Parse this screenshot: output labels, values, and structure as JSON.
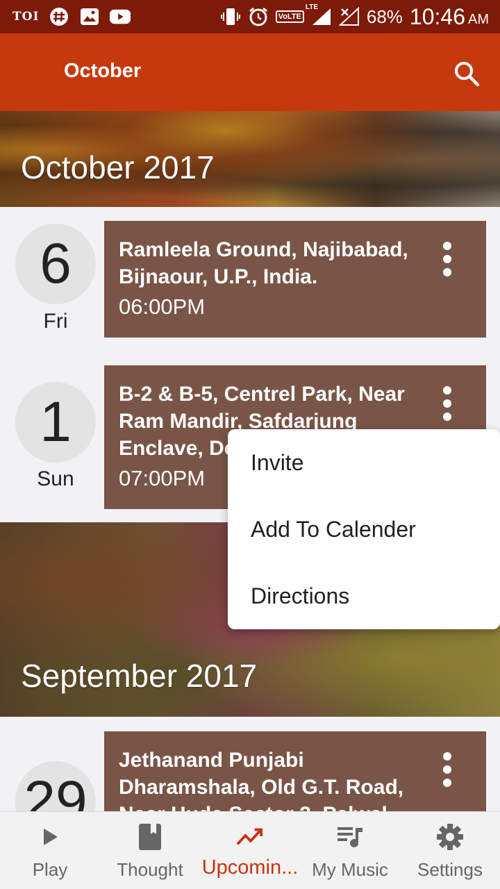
{
  "status_bar": {
    "carrier_label": "TOI",
    "volte_label": "VoLTE",
    "lte_label": "LTE",
    "battery": "68%",
    "time": "10:46",
    "ampm": "AM"
  },
  "app_bar": {
    "title": "October",
    "search_icon": "search-icon"
  },
  "sections": [
    {
      "month": "October 2017",
      "events": [
        {
          "day": "6",
          "weekday": "Fri",
          "location": "Ramleela Ground, Najibabad, Bijnaour, U.P., India.",
          "time": "06:00PM"
        },
        {
          "day": "1",
          "weekday": "Sun",
          "location": "B-2 & B-5, Centrel Park, Near Ram Mandir, Safdarjung Enclave, De",
          "time": "07:00PM"
        }
      ]
    },
    {
      "month": "September 2017",
      "events": [
        {
          "day": "29",
          "weekday": "",
          "location": "Jethanand Punjabi Dharamshala, Old G.T. Road, Near Huda Sector 2, Palwal",
          "time": ""
        }
      ]
    }
  ],
  "popup_menu": {
    "items": [
      "Invite",
      "Add To Calender",
      "Directions"
    ]
  },
  "bottom_nav": {
    "items": [
      {
        "label": "Play",
        "icon": "play-icon",
        "active": false
      },
      {
        "label": "Thought",
        "icon": "book-icon",
        "active": false
      },
      {
        "label": "Upcomin...",
        "icon": "trending-up-icon",
        "active": true
      },
      {
        "label": "My Music",
        "icon": "playlist-icon",
        "active": false
      },
      {
        "label": "Settings",
        "icon": "gear-icon",
        "active": false
      }
    ]
  },
  "colors": {
    "status_bar": "#7d1a08",
    "app_bar": "#c43a0e",
    "card": "#795548",
    "active_nav": "#c8320e"
  }
}
